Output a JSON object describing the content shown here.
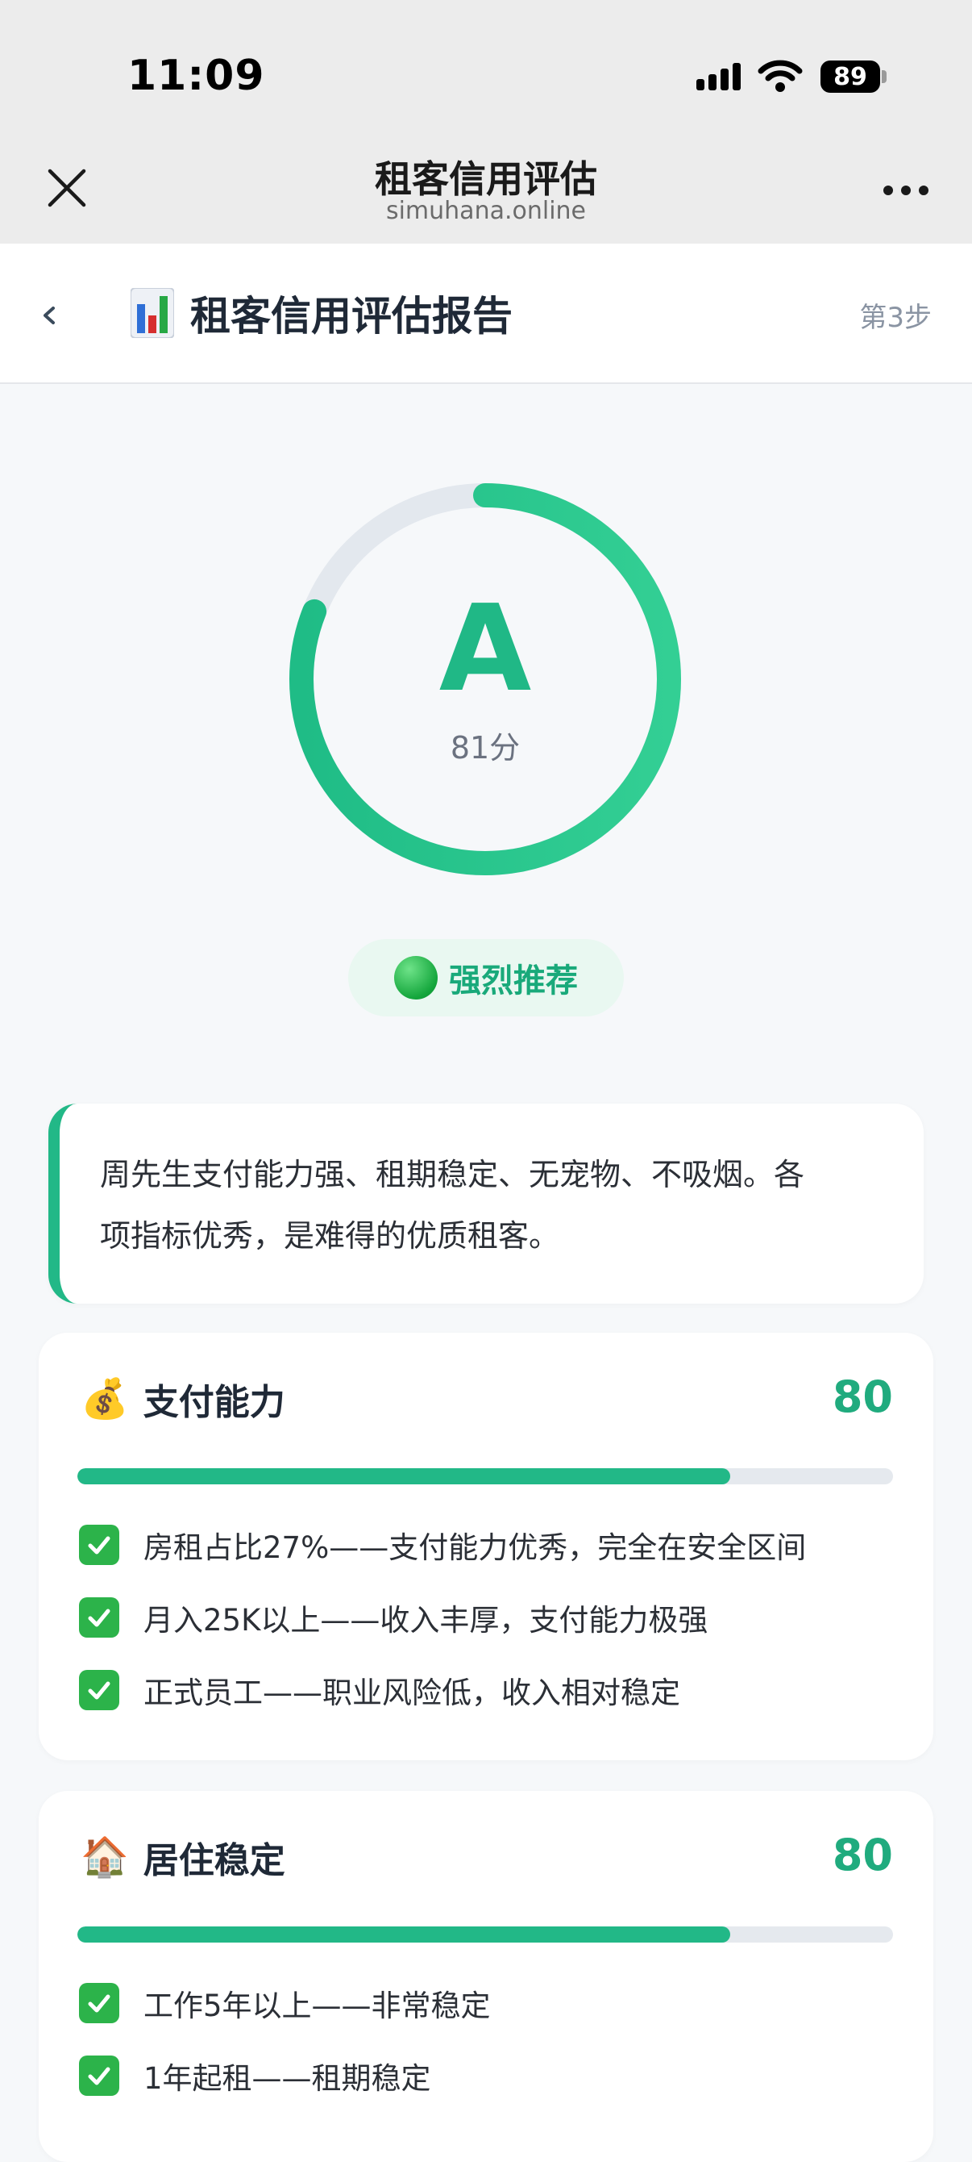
{
  "status_bar": {
    "time": "11:09",
    "battery": "89"
  },
  "browser": {
    "title": "租客信用评估",
    "url": "simuhana.online"
  },
  "header": {
    "title": "租客信用评估报告",
    "step": "第3步",
    "title_icon": "bar-chart-icon"
  },
  "grade": {
    "letter": "A",
    "score_text": "81分",
    "score": 81,
    "max": 100,
    "color": "#20b886"
  },
  "recommendation": {
    "label": "强烈推荐",
    "icon": "green-circle-icon"
  },
  "summary": {
    "lines": [
      "周先生支付能力强、租期稳定、无宠物、不吸烟。各",
      "项指标优秀，是难得的优质租客。"
    ]
  },
  "metrics": [
    {
      "icon": "💰",
      "name": "支付能力",
      "score": "80",
      "fraction": 0.8,
      "items": [
        "房租占比27%——支付能力优秀，完全在安全区间",
        "月入25K以上——收入丰厚，支付能力极强",
        "正式员工——职业风险低，收入相对稳定"
      ]
    },
    {
      "icon": "🏠",
      "name": "居住稳定",
      "score": "80",
      "fraction": 0.8,
      "items": [
        "工作5年以上——非常稳定",
        "1年起租——租期稳定"
      ]
    }
  ],
  "colors": {
    "accent": "#22b887",
    "track": "#e5e9ee",
    "ring_track": "#e3e8ee",
    "check": "#2cb34a"
  }
}
